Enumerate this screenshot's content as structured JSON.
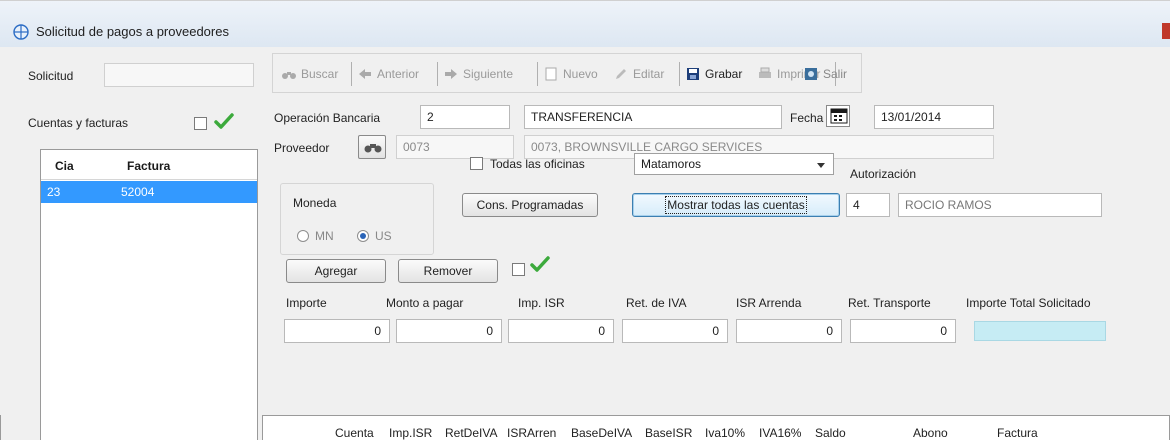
{
  "window": {
    "title": "Solicitud de pagos a proveedores"
  },
  "left": {
    "solicitud_label": "Solicitud",
    "solicitud_value": "",
    "cuentas_label": "Cuentas y facturas",
    "grid": {
      "columns": [
        "Cia",
        "Factura"
      ],
      "rows": [
        {
          "cia": "23",
          "factura": "52004"
        }
      ]
    }
  },
  "toolbar": {
    "buscar": "Buscar",
    "anterior": "Anterior",
    "siguiente": "Siguiente",
    "nuevo": "Nuevo",
    "editar": "Editar",
    "grabar": "Grabar",
    "imprimir": "Imprimir",
    "salir": "Salir"
  },
  "form": {
    "operacion_label": "Operación Bancaria",
    "operacion_value": "2",
    "operacion_desc": "TRANSFERENCIA",
    "fecha_label": "Fecha",
    "fecha_value": "13/01/2014",
    "proveedor_label": "Proveedor",
    "proveedor_code": "0073",
    "proveedor_name": "0073, BROWNSVILLE CARGO SERVICES",
    "moneda_label": "Moneda",
    "moneda_mn": "MN",
    "moneda_us": "US",
    "todas_oficinas": "Todas las oficinas",
    "oficina_selected": "Matamoros",
    "cons_programadas": "Cons. Programadas",
    "mostrar_todas": "Mostrar todas las cuentas",
    "autorizacion_label": "Autorización",
    "autorizacion_code": "4",
    "autorizacion_name": "ROCIO RAMOS",
    "agregar": "Agregar",
    "remover": "Remover",
    "totals": {
      "importe_label": "Importe",
      "importe_value": "0",
      "monto_label": "Monto a pagar",
      "monto_value": "0",
      "imp_isr_label": "Imp. ISR",
      "imp_isr_value": "0",
      "ret_iva_label": "Ret. de IVA",
      "ret_iva_value": "0",
      "isr_arrenda_label": "ISR Arrenda",
      "isr_arrenda_value": "0",
      "ret_transporte_label": "Ret. Transporte",
      "ret_transporte_value": "0",
      "importe_total_label": "Importe Total Solicitado",
      "importe_total_value": ""
    }
  },
  "bottom_grid": {
    "columns": [
      "Cuenta",
      "Imp.ISR",
      "RetDeIVA",
      "ISRArren",
      "BaseDeIVA",
      "BaseISR",
      "Iva10%",
      "IVA16%",
      "Saldo",
      "Abono",
      "Factura"
    ]
  },
  "colors": {
    "selection": "#3399ff",
    "total_field": "#c6ecf4",
    "check_green": "#3caa3c"
  }
}
